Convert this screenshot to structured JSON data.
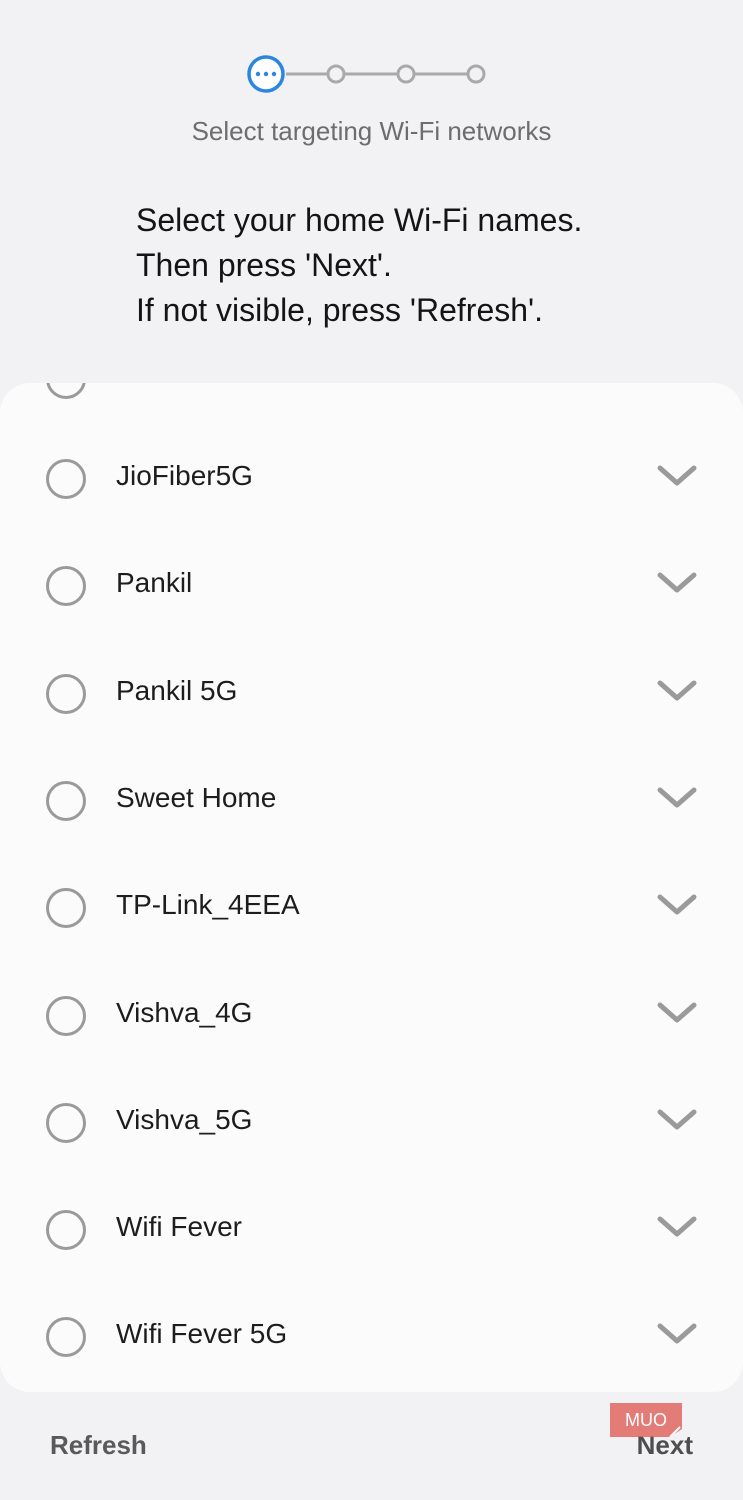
{
  "stepper": {
    "step_title": "Select targeting Wi-Fi networks",
    "current_step": 1,
    "total_steps": 4,
    "accent_color": "#2a86e0"
  },
  "instructions": {
    "line1": "Select your home Wi-Fi names.",
    "line2": "Then press 'Next'.",
    "line3": "If not visible, press 'Refresh'."
  },
  "networks": [
    {
      "name": "JioFiber5G",
      "selected": false
    },
    {
      "name": "Pankil",
      "selected": false
    },
    {
      "name": "Pankil 5G",
      "selected": false
    },
    {
      "name": "Sweet Home",
      "selected": false
    },
    {
      "name": "TP-Link_4EEA",
      "selected": false
    },
    {
      "name": "Vishva_4G",
      "selected": false
    },
    {
      "name": "Vishva_5G",
      "selected": false
    },
    {
      "name": "Wifi Fever",
      "selected": false
    },
    {
      "name": "Wifi Fever 5G",
      "selected": false
    }
  ],
  "footer": {
    "refresh_label": "Refresh",
    "next_label": "Next"
  },
  "watermark": {
    "text": "MUO",
    "color": "#e0675f"
  },
  "icons": {
    "row_expand": "chevron-down-icon",
    "row_select": "radio-button"
  }
}
